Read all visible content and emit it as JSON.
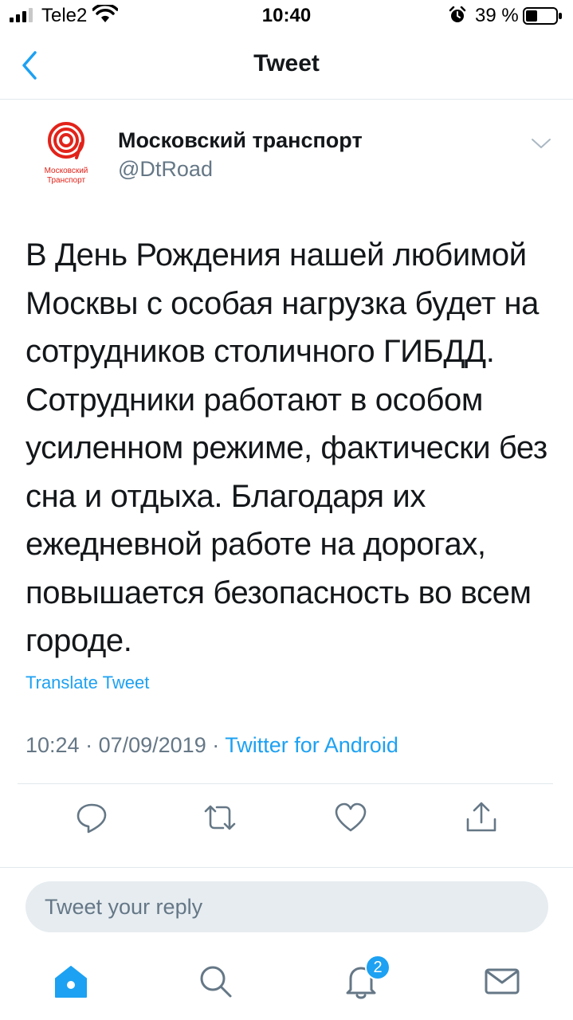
{
  "status_bar": {
    "carrier": "Tele2",
    "time": "10:40",
    "battery_percent": "39 %",
    "battery_level": 0.39
  },
  "nav": {
    "title": "Tweet"
  },
  "tweet": {
    "author": {
      "name": "Московский транспорт",
      "handle": "@DtRoad",
      "avatar_caption": "Московский Транспорт"
    },
    "text": "В День Рождения нашей любимой Москвы с особая нагрузка будет на сотрудников столичного ГИБДД. Сотрудники работают в особом усиленном режиме, фактически без сна и отдыха. Благодаря их ежедневной работе на дорогах, повышается безопасность во всем городе.",
    "translate_label": "Translate Tweet",
    "time": "10:24",
    "date": "07/09/2019",
    "source": "Twitter for Android",
    "separator": " · "
  },
  "reply": {
    "placeholder": "Tweet your reply"
  },
  "tabbar": {
    "notifications_badge": "2"
  },
  "colors": {
    "accent": "#1da1f2",
    "brand_red": "#e2231a",
    "text": "#14171a",
    "muted": "#657786"
  }
}
